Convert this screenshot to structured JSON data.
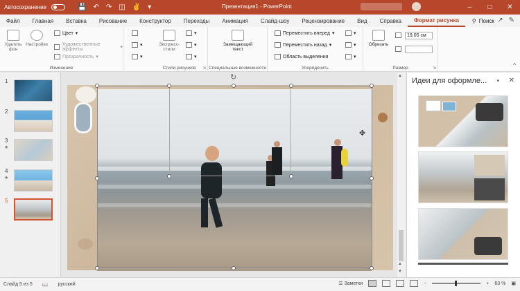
{
  "titlebar": {
    "autosave_label": "Автосохранение",
    "autosave_state": "off",
    "title": "Презентация1 - PowerPoint",
    "window_controls": [
      "–",
      "□",
      "✕"
    ]
  },
  "tabs": {
    "items": [
      "Файл",
      "Главная",
      "Вставка",
      "Рисование",
      "Конструктор",
      "Переходы",
      "Анимация",
      "Слайд-шоу",
      "Рецензирование",
      "Вид",
      "Справка",
      "Формат рисунка"
    ],
    "active": "Формат рисунка",
    "search_label": "Поиск"
  },
  "ribbon": {
    "adjust": {
      "remove_bg": "Удалить фон",
      "corrections": "Настройки",
      "color": "Цвет",
      "artistic": "Художественные эффекты",
      "transparency": "Прозрачность",
      "label": "Изменение"
    },
    "styles": {
      "express": "Экспресс-стили",
      "label": "Стили рисунков"
    },
    "accessibility": {
      "alt_text": "Замещающий текст",
      "label": "Специальные возможности"
    },
    "arrange": {
      "forward": "Переместить вперед",
      "backward": "Переместить назад",
      "selection": "Область выделения",
      "label": "Упорядочить"
    },
    "size": {
      "crop": "Обрезать",
      "height": "19,05 см",
      "width": "",
      "label": "Размер"
    }
  },
  "slides": {
    "numbers": [
      "1",
      "2",
      "3",
      "4",
      "5"
    ],
    "active_index": 5
  },
  "designer": {
    "title": "Идеи для оформле..."
  },
  "statusbar": {
    "slide_info": "Слайд 5 из 5",
    "language": "русский",
    "notes_label": "Заметки",
    "zoom": "63 %"
  },
  "colors": {
    "brand": "#b7472a",
    "accent_tab": "#b7472a",
    "selected_thumb_border": "#d35230"
  },
  "icons": {
    "search": "search-icon",
    "close": "close-icon",
    "save": "save-icon",
    "undo": "undo-icon",
    "redo": "redo-icon"
  }
}
